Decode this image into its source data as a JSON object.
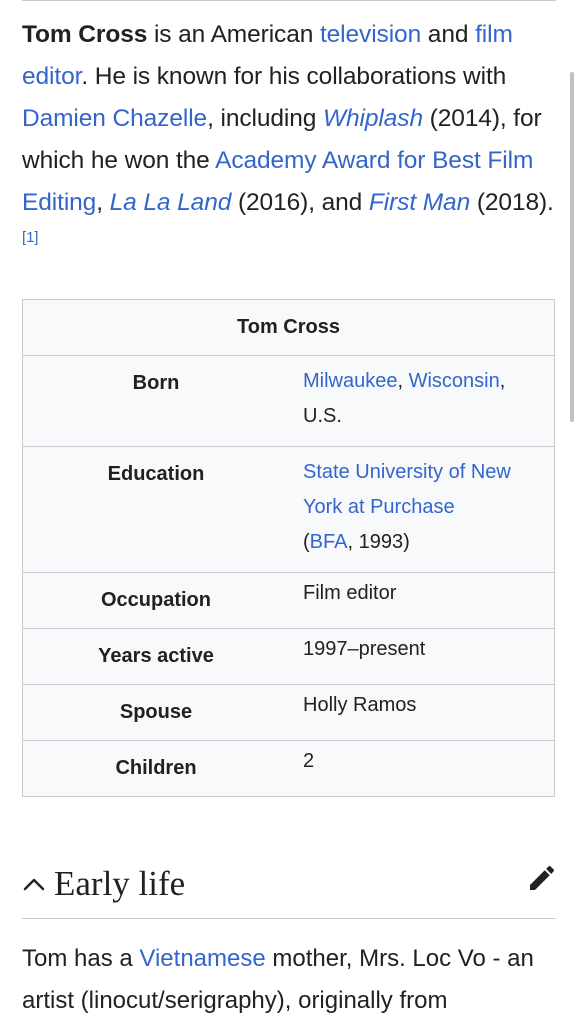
{
  "lead": {
    "subject": "Tom Cross",
    "t1": " is an American ",
    "link_television": "television",
    "t2": " and ",
    "link_film_editor": "film editor",
    "t3": ". He is known for his collaborations with ",
    "link_damien": "Damien Chazelle",
    "t4": ", including ",
    "link_whiplash": "Whiplash",
    "t5": " (2014), for which he won the ",
    "link_academy": "Academy Award for Best Film Editing",
    "t6": ", ",
    "link_lalaland": "La La Land",
    "t7": " (2016), and ",
    "link_firstman": "First Man",
    "t8": " (2018).",
    "ref": "[1]"
  },
  "infobox": {
    "title": "Tom Cross",
    "born_label": "Born",
    "born_link1": "Milwaukee",
    "born_sep": ", ",
    "born_link2": "Wisconsin",
    "born_rest": ", U.S.",
    "education_label": "Education",
    "education_link": "State University of New York at Purchase",
    "education_paren_open": "(",
    "education_link2": "BFA",
    "education_rest": ", 1993)",
    "occupation_label": "Occupation",
    "occupation_value": "Film editor",
    "years_label": "Years active",
    "years_value": "1997–present",
    "spouse_label": "Spouse",
    "spouse_value": "Holly Ramos",
    "children_label": "Children",
    "children_value": "2"
  },
  "section": {
    "title": "Early life",
    "chevron_icon": "chevron-up-icon",
    "edit_icon": "pencil-icon"
  },
  "early_life": {
    "t1": "Tom has a ",
    "link_vietnamese": "Vietnamese",
    "t2": " mother, Mrs. Loc Vo - an artist (linocut/serigraphy), originally from"
  },
  "colors": {
    "link": "#3366cc",
    "text": "#202122",
    "infobox_bg": "#f8f9fa",
    "border": "#c8ccd1"
  }
}
